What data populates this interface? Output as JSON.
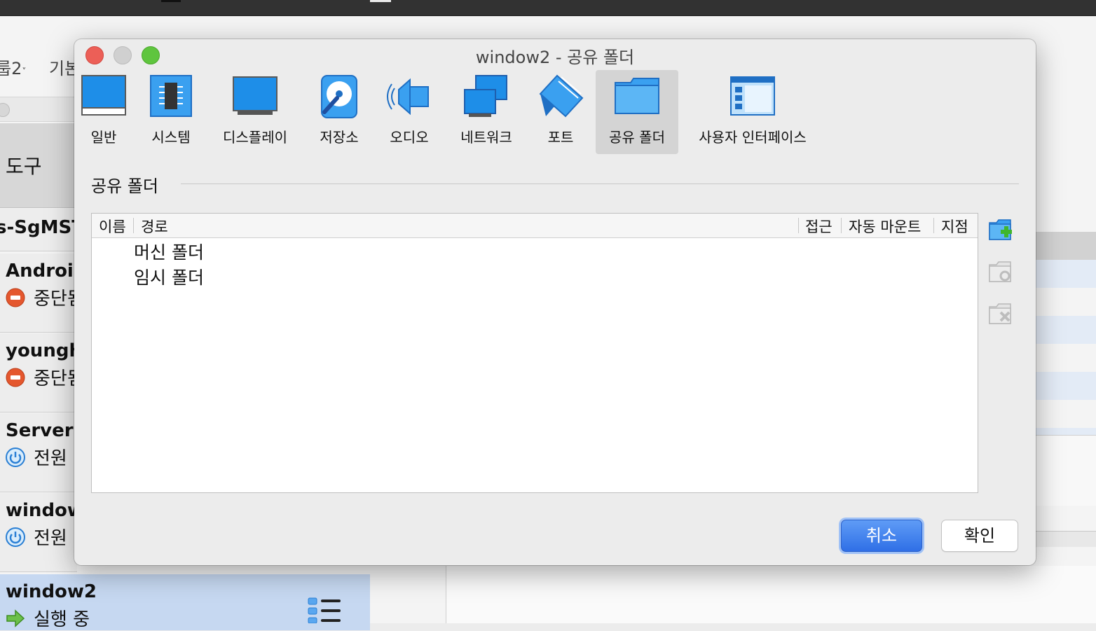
{
  "background": {
    "toolbar": {
      "group_label": "룹2",
      "basic_label": "기본"
    },
    "tools_label": "도구",
    "vms": [
      {
        "name": "s-SgMST",
        "status": ""
      },
      {
        "name": "Android",
        "status": "중단됨"
      },
      {
        "name": "younghi",
        "status": "중단됨"
      },
      {
        "name": "Server",
        "status": "전원"
      },
      {
        "name": "window",
        "status": "전원"
      },
      {
        "name": "window2",
        "status": "실행 중"
      }
    ]
  },
  "dialog": {
    "title": "window2 - 공유 폴더",
    "tabs": [
      {
        "label": "일반",
        "icon": "general-icon"
      },
      {
        "label": "시스템",
        "icon": "system-chip-icon"
      },
      {
        "label": "디스플레이",
        "icon": "display-icon"
      },
      {
        "label": "저장소",
        "icon": "storage-disk-icon"
      },
      {
        "label": "오디오",
        "icon": "audio-speaker-icon"
      },
      {
        "label": "네트워크",
        "icon": "network-icon"
      },
      {
        "label": "포트",
        "icon": "port-icon"
      },
      {
        "label": "공유 폴더",
        "icon": "shared-folder-icon"
      },
      {
        "label": "사용자 인터페이스",
        "icon": "user-interface-icon"
      }
    ],
    "active_tab": "공유 폴더",
    "section_title": "공유 폴더",
    "table": {
      "columns": [
        "이름",
        "경로",
        "접근",
        "자동 마운트",
        "지점"
      ],
      "rows": [
        "머신 폴더",
        "임시 폴더"
      ]
    },
    "buttons": {
      "cancel": "취소",
      "ok": "확인"
    },
    "colors": {
      "accent": "#2f6fe6",
      "icon_blue": "#1e8ee8",
      "close": "#ec5f57",
      "maximize": "#5fc53e"
    }
  }
}
